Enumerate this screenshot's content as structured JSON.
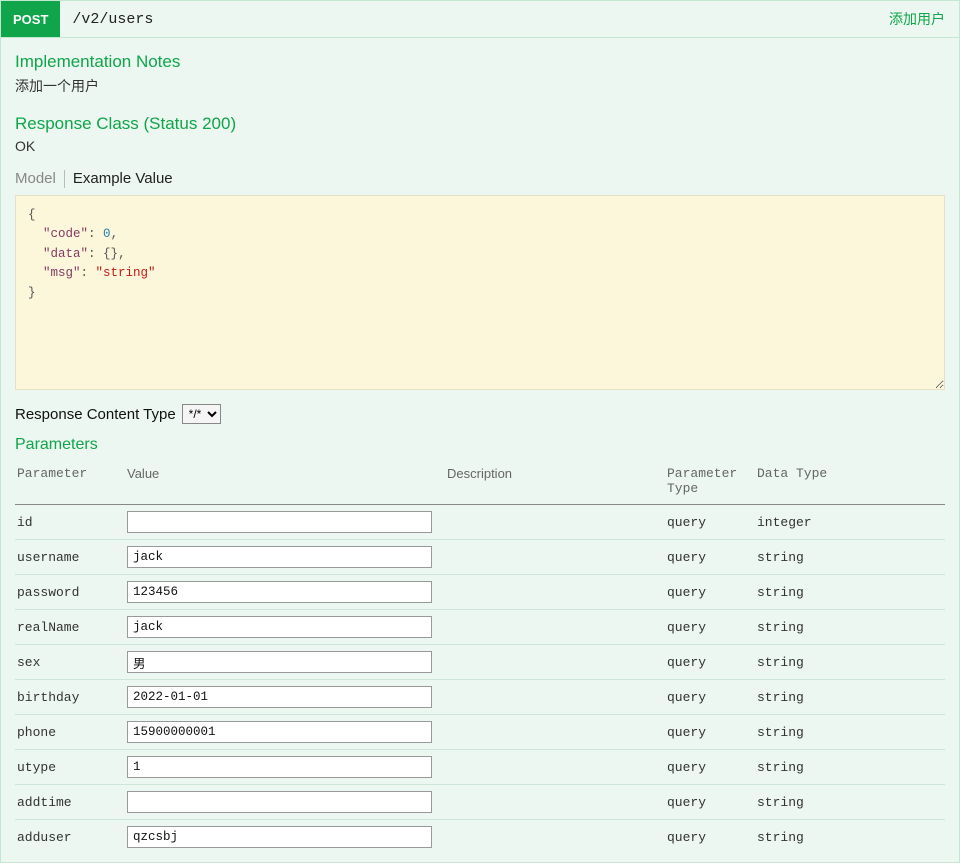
{
  "header": {
    "method": "POST",
    "path": "/v2/users",
    "summary": "添加用户"
  },
  "notes": {
    "title": "Implementation Notes",
    "text": "添加一个用户"
  },
  "response_class": {
    "title": "Response Class (Status 200)",
    "status": "OK"
  },
  "tabs": {
    "model": "Model",
    "example": "Example Value"
  },
  "example_json": {
    "line1_open": "{",
    "line2_key": "\"code\"",
    "line2_sep": ": ",
    "line2_val": "0",
    "line2_end": ",",
    "line3_key": "\"data\"",
    "line3_sep": ": ",
    "line3_val": "{}",
    "line3_end": ",",
    "line4_key": "\"msg\"",
    "line4_sep": ": ",
    "line4_val": "\"string\"",
    "line5_close": "}"
  },
  "response_content_type": {
    "label": "Response Content Type",
    "selected": "*/*"
  },
  "parameters": {
    "title": "Parameters",
    "headers": {
      "parameter": "Parameter",
      "value": "Value",
      "description": "Description",
      "parameter_type": "Parameter Type",
      "data_type": "Data Type"
    },
    "rows": [
      {
        "name": "id",
        "value": "",
        "description": "",
        "ptype": "query",
        "dtype": "integer"
      },
      {
        "name": "username",
        "value": "jack",
        "description": "",
        "ptype": "query",
        "dtype": "string"
      },
      {
        "name": "password",
        "value": "123456",
        "description": "",
        "ptype": "query",
        "dtype": "string"
      },
      {
        "name": "realName",
        "value": "jack",
        "description": "",
        "ptype": "query",
        "dtype": "string"
      },
      {
        "name": "sex",
        "value": "男",
        "description": "",
        "ptype": "query",
        "dtype": "string"
      },
      {
        "name": "birthday",
        "value": "2022-01-01",
        "description": "",
        "ptype": "query",
        "dtype": "string"
      },
      {
        "name": "phone",
        "value": "15900000001",
        "description": "",
        "ptype": "query",
        "dtype": "string"
      },
      {
        "name": "utype",
        "value": "1",
        "description": "",
        "ptype": "query",
        "dtype": "string"
      },
      {
        "name": "addtime",
        "value": "",
        "description": "",
        "ptype": "query",
        "dtype": "string"
      },
      {
        "name": "adduser",
        "value": "qzcsbj",
        "description": "",
        "ptype": "query",
        "dtype": "string"
      }
    ]
  }
}
